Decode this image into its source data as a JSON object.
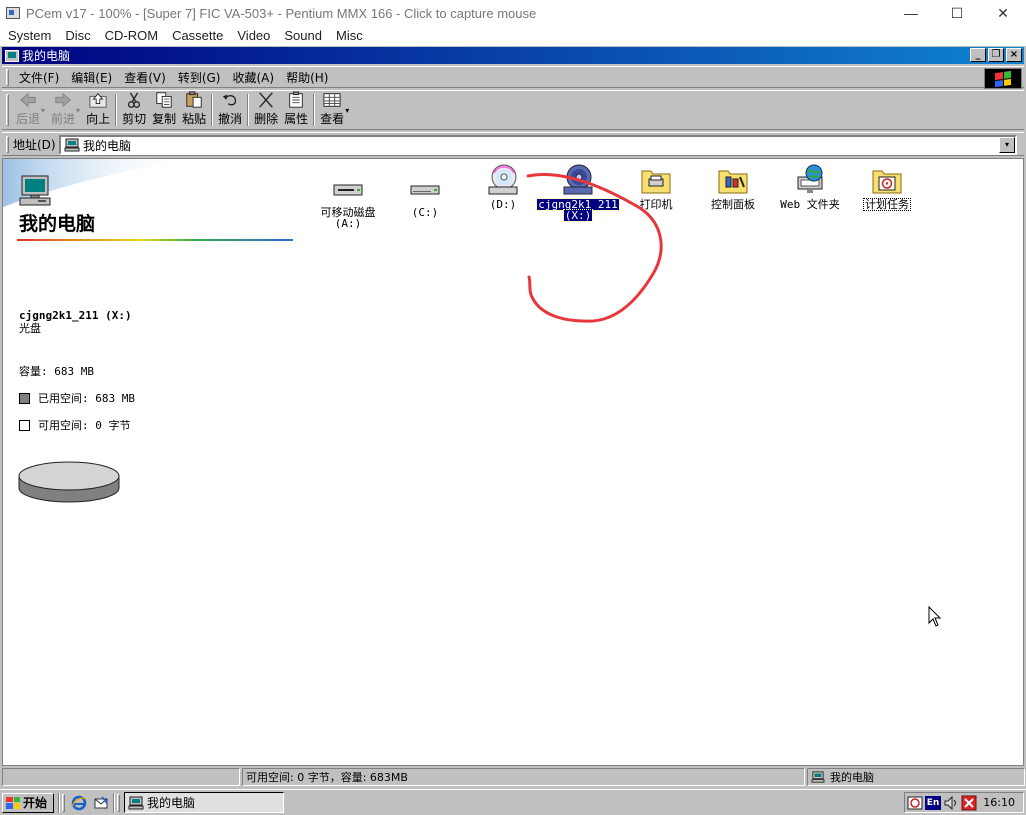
{
  "host": {
    "title": "PCem v17 - 100% - [Super 7] FIC VA-503+ - Pentium MMX 166 - Click to capture mouse",
    "controls": {
      "minimize": "—",
      "maximize": "☐",
      "close": "✕"
    },
    "menu": [
      "System",
      "Disc",
      "CD-ROM",
      "Cassette",
      "Video",
      "Sound",
      "Misc"
    ]
  },
  "window": {
    "title": "我的电脑",
    "title_buttons": {
      "minimize": "_",
      "restore": "❐",
      "close": "×"
    }
  },
  "menubar": [
    "文件(F)",
    "编辑(E)",
    "查看(V)",
    "转到(G)",
    "收藏(A)",
    "帮助(H)"
  ],
  "toolbar": {
    "back": "后退",
    "forward": "前进",
    "up": "向上",
    "cut": "剪切",
    "copy": "复制",
    "paste": "粘贴",
    "undo": "撤消",
    "delete": "删除",
    "properties": "属性",
    "views": "查看",
    "dropdown": "▾"
  },
  "address": {
    "label": "地址(D)",
    "value": "我的电脑",
    "dropdown": "▾"
  },
  "page": {
    "title": "我的电脑"
  },
  "info": {
    "drive_name": "cjgng2k1_211 (X:)",
    "drive_type": "光盘",
    "capacity": "容量: 683 MB",
    "used": "已用空间: 683 MB",
    "free": "可用空间: 0 字节",
    "used_fraction": 1.0
  },
  "icons": [
    {
      "name": "removable",
      "label_line1": "可移动磁盘",
      "label_line2": "(A:)",
      "icon": "floppy-drive-icon"
    },
    {
      "name": "drive-c",
      "label_line1": "(C:)",
      "label_line2": "",
      "icon": "hard-drive-icon"
    },
    {
      "name": "drive-d",
      "label_line1": "(D:)",
      "label_line2": "",
      "icon": "cd-drive-icon"
    },
    {
      "name": "drive-x",
      "label_line1": "cjgng2k1_211",
      "label_line2": "(X:)",
      "icon": "cd-drive-icon",
      "selected": true
    },
    {
      "name": "printers",
      "label_line1": "打印机",
      "label_line2": "",
      "icon": "printers-folder-icon"
    },
    {
      "name": "control-panel",
      "label_line1": "控制面板",
      "label_line2": "",
      "icon": "control-panel-icon"
    },
    {
      "name": "web-folders",
      "label_line1": "Web 文件夹",
      "label_line2": "",
      "icon": "web-folder-icon"
    },
    {
      "name": "scheduled-tasks",
      "label_line1": "计划任务",
      "label_line2": "",
      "icon": "scheduled-tasks-icon"
    }
  ],
  "statusbar": {
    "cell1": "",
    "cell2": "可用空间: 0 字节，容量: 683MB",
    "cell3": "我的电脑"
  },
  "taskbar": {
    "start": "开始",
    "task_label": "我的电脑",
    "lang": "En",
    "clock": "16:10"
  },
  "colors": {
    "selection": "#000080",
    "annotation_stroke": "#e8373a",
    "title_gradient_start": "#000080",
    "title_gradient_end": "#1084d0"
  }
}
